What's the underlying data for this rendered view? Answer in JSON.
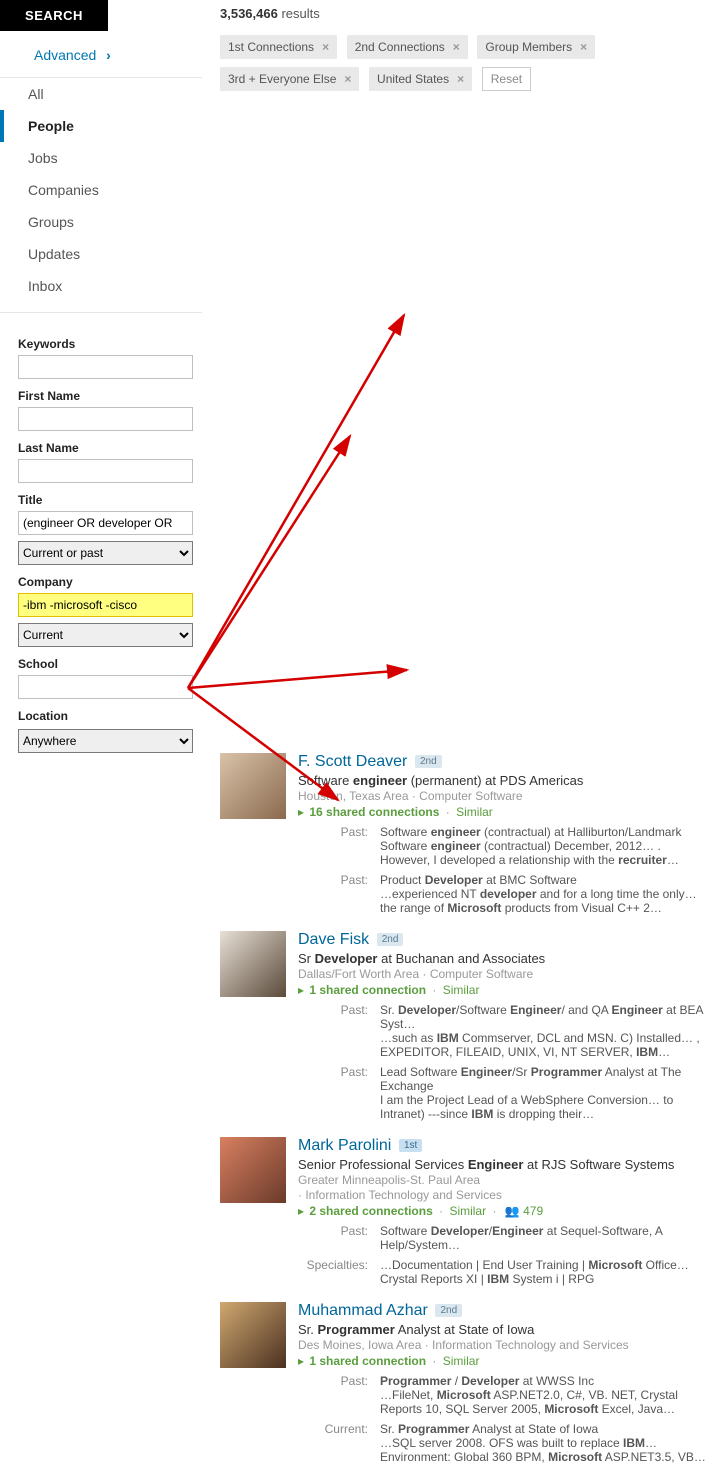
{
  "search_button": "SEARCH",
  "advanced_label": "Advanced",
  "results_count_number": "3,536,466",
  "results_count_suffix": "results",
  "nav": {
    "all": "All",
    "people": "People",
    "jobs": "Jobs",
    "companies": "Companies",
    "groups": "Groups",
    "updates": "Updates",
    "inbox": "Inbox"
  },
  "chips": {
    "c1": "1st Connections",
    "c2": "2nd Connections",
    "c3": "Group Members",
    "c4": "3rd + Everyone Else",
    "c5": "United States",
    "reset": "Reset"
  },
  "filters": {
    "keywords_label": "Keywords",
    "keywords_value": "",
    "first_name_label": "First Name",
    "first_name_value": "",
    "last_name_label": "Last Name",
    "last_name_value": "",
    "title_label": "Title",
    "title_value": "(engineer OR developer OR",
    "title_scope": "Current or past",
    "company_label": "Company",
    "company_value": "-ibm -microsoft -cisco",
    "company_scope": "Current",
    "school_label": "School",
    "school_value": "",
    "location_label": "Location",
    "location_value": "Anywhere"
  },
  "labels": {
    "past": "Past:",
    "current": "Current:",
    "specialties": "Specialties:",
    "similar": "Similar"
  },
  "results": [
    {
      "name": "F. Scott Deaver",
      "degree": "2nd",
      "headline_html": "Software <b>engineer</b> (permanent) at PDS Americas",
      "meta": "Houston, Texas Area · Computer Software",
      "shared": "16 shared connections",
      "rows": [
        {
          "label": "Past:",
          "html": "Software <b>engineer</b> (contractual) at Halliburton/Landmark<br>Software <b>engineer</b> (contractual) December, 2012… . However, I developed a relationship with the <b>recruiter</b>…"
        },
        {
          "label": "Past:",
          "html": "Product <b>Developer</b> at BMC Software<br>…experienced NT <b>developer</b> and for a long time the only… the range of <b>Microsoft</b> products from Visual C++ 2…"
        }
      ]
    },
    {
      "name": "Dave Fisk",
      "degree": "2nd",
      "headline_html": "Sr <b>Developer</b> at Buchanan and Associates",
      "meta": "Dallas/Fort Worth Area · Computer Software",
      "shared": "1 shared connection",
      "rows": [
        {
          "label": "Past:",
          "html": "Sr. <b>Developer</b>/Software <b>Engineer</b>/ and QA <b>Engineer</b> at BEA Syst…<br>…such as <b>IBM</b> Commserver, DCL and MSN. C) Installed… ,<br>EXPEDITOR, FILEAID, UNIX, VI, NT SERVER, <b>IBM</b>…"
        },
        {
          "label": "Past:",
          "html": "Lead Software <b>Engineer</b>/Sr <b>Programmer</b> Analyst at The Exchange<br>I am the Project Lead of a WebSphere Conversion… to Intranet) ---since <b>IBM</b> is dropping their…"
        }
      ]
    },
    {
      "name": "Mark Parolini",
      "degree": "1st",
      "headline_html": "Senior Professional Services <b>Engineer</b> at RJS Software Systems",
      "meta": "Greater Minneapolis-St. Paul Area",
      "meta2": "· Information Technology and Services",
      "shared": "2 shared connections",
      "group_count": "479",
      "rows": [
        {
          "label": "Past:",
          "html": "Software <b>Developer</b>/<b>Engineer</b> at Sequel-Software, A Help/System…"
        },
        {
          "label": "Specialties:",
          "html": "…Documentation | End User Training | <b>Microsoft</b> Office… Crystal Reports XI | <b>IBM</b> System i | RPG"
        }
      ]
    },
    {
      "name": "Muhammad Azhar",
      "degree": "2nd",
      "headline_html": "Sr. <b>Programmer</b> Analyst at State of Iowa",
      "meta": "Des Moines, Iowa Area · Information Technology and Services",
      "shared": "1 shared connection",
      "rows": [
        {
          "label": "Past:",
          "html": "<b>Programmer</b> / <b>Developer</b> at WWSS Inc<br>…FileNet, <b>Microsoft</b> ASP.NET2.0, C#, VB. NET, Crystal Reports 10, SQL Server 2005, <b>Microsoft</b> Excel, Java…"
        },
        {
          "label": "Current:",
          "html": "Sr. <b>Programmer</b> Analyst at State of Iowa<br>…SQL server 2008. OFS was built to replace <b>IBM</b>… Environment: Global 360 BPM, <b>Microsoft</b> ASP.NET3.5, VB…"
        }
      ]
    }
  ]
}
